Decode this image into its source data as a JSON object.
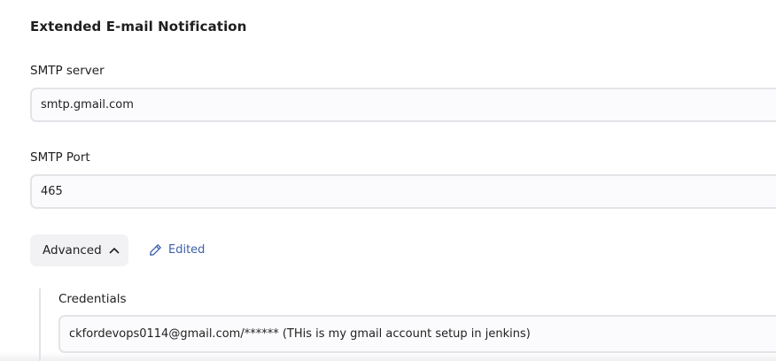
{
  "section": {
    "title": "Extended E-mail Notification"
  },
  "smtp_server": {
    "label": "SMTP server",
    "value": "smtp.gmail.com"
  },
  "smtp_port": {
    "label": "SMTP Port",
    "value": "465"
  },
  "advanced": {
    "label": "Advanced",
    "icon": "chevron-up-icon",
    "expanded": true
  },
  "edited": {
    "label": "Edited",
    "icon": "pencil-icon",
    "color": "#3c5fa8"
  },
  "credentials": {
    "label": "Credentials",
    "selected": "ckfordevops0114@gmail.com/****** (THis is my gmail account setup in jenkins)"
  }
}
